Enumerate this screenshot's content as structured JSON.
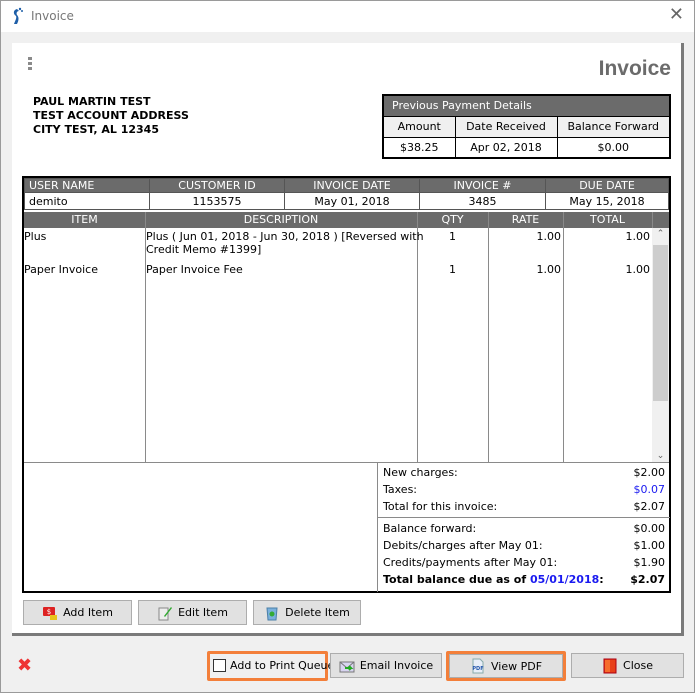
{
  "window": {
    "title": "Invoice",
    "close_glyph": "✕"
  },
  "header": {
    "title": "Invoice",
    "address_lines": [
      "PAUL MARTIN TEST",
      "TEST ACCOUNT ADDRESS",
      "CITY TEST, AL 12345"
    ]
  },
  "previous_payment": {
    "title": "Previous Payment Details",
    "columns": [
      "Amount",
      "Date Received",
      "Balance Forward"
    ],
    "values": [
      "$38.25",
      "Apr 02, 2018",
      "$0.00"
    ]
  },
  "meta": {
    "columns": [
      "USER NAME",
      "CUSTOMER ID",
      "INVOICE DATE",
      "INVOICE #",
      "DUE DATE"
    ],
    "values": [
      "demito",
      "1153575",
      "May 01, 2018",
      "3485",
      "May 15, 2018"
    ]
  },
  "items": {
    "columns": [
      "ITEM",
      "DESCRIPTION",
      "QTY",
      "RATE",
      "TOTAL"
    ],
    "rows": [
      {
        "item": "Plus",
        "description_1": "Plus ( Jun 01, 2018 - Jun 30, 2018 ) [Reversed with",
        "description_2": "Credit Memo #1399]",
        "qty": "1",
        "rate": "1.00",
        "total": "1.00"
      },
      {
        "item": "Paper Invoice",
        "description_1": "Paper Invoice Fee",
        "description_2": "",
        "qty": "1",
        "rate": "1.00",
        "total": "1.00"
      }
    ],
    "scroll_up": "⌃",
    "scroll_down": "⌄"
  },
  "summary": {
    "new_charges_label": "New charges:",
    "new_charges": "$2.00",
    "taxes_label": "Taxes:",
    "taxes": "$0.07",
    "total_invoice_label": "Total for this invoice:",
    "total_invoice": "$2.07",
    "balance_forward_label": "Balance forward:",
    "balance_forward": "$0.00",
    "debits_label": "Debits/charges after May 01:",
    "debits": "$1.00",
    "credits_label": "Credits/payments after May 01:",
    "credits": "$1.90",
    "total_due_label": "Total balance due as of ",
    "total_due_date": "05/01/2018",
    "total_due_colon": ":",
    "total_due": "$2.07"
  },
  "item_buttons": {
    "add": "Add Item",
    "edit": "Edit Item",
    "delete": "Delete Item"
  },
  "footer": {
    "print_queue_label": "Add to Print Queue",
    "print_queue_checked": false,
    "email": "Email Invoice",
    "view_pdf": "View PDF",
    "close": "Close"
  },
  "colors": {
    "header_bg": "#6b6b6b",
    "highlight": "#f37f3a",
    "link_blue": "#1a1af0"
  }
}
